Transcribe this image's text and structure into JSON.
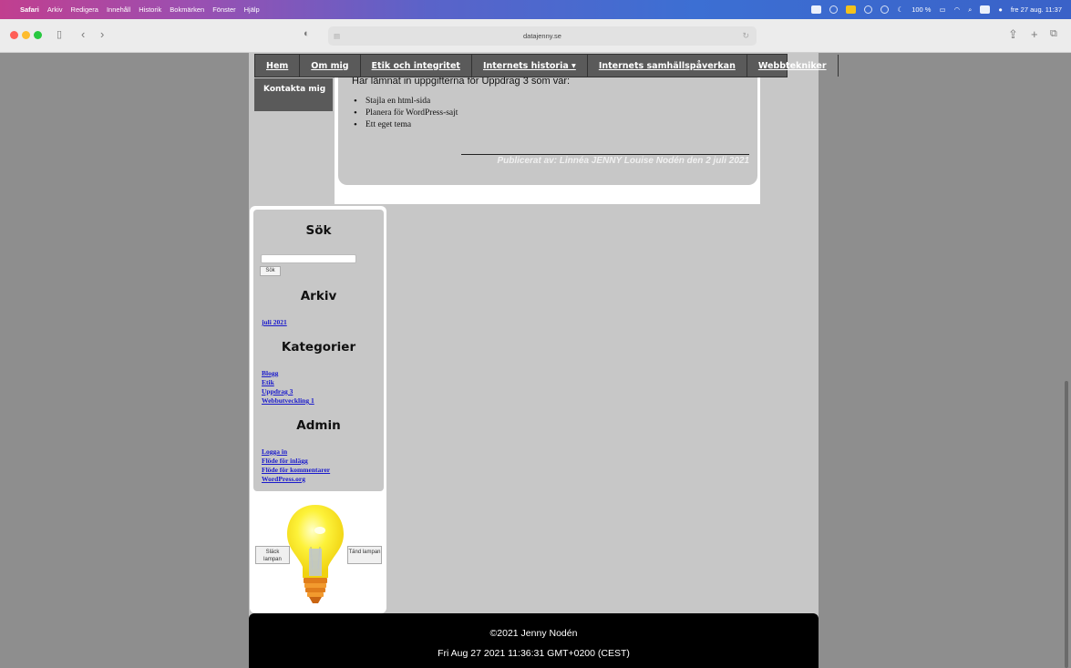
{
  "menubar": {
    "apple": "",
    "items": [
      "Safari",
      "Arkiv",
      "Redigera",
      "Innehåll",
      "Historik",
      "Bokmärken",
      "Fönster",
      "Hjälp"
    ],
    "battery": "100 %",
    "datetime": "fre 27 aug. 11:37"
  },
  "browser": {
    "url": "datajenny.se"
  },
  "nav": {
    "items": [
      "Hem",
      "Om mig",
      "Etik och integritet",
      "Internets historia ▾",
      "Internets samhällspåverkan",
      "Webbtekniker"
    ],
    "second_row": "Kontakta mig"
  },
  "post": {
    "intro": "Har lämnat in uppgifterna för Uppdrag 3 som var:",
    "items": [
      "Stajla en html-sida",
      "Planera för WordPress-sajt",
      "Ett eget tema"
    ],
    "byline": "Publicerat av: Linnéa JENNY Louise Nodén den 2 juli 2021"
  },
  "sidebar": {
    "search_heading": "Sök",
    "search_button": "Sök",
    "archive_heading": "Arkiv",
    "archive_links": [
      "juli 2021"
    ],
    "categories_heading": "Kategorier",
    "category_links": [
      "Blogg",
      "Etik",
      "Uppdrag 3",
      "Webbutveckling 1"
    ],
    "admin_heading": "Admin",
    "admin_links": [
      "Logga in",
      "Flöde för inlägg",
      "Flöde för kommentarer",
      "WordPress.org"
    ]
  },
  "lamp": {
    "off_button": "Släck lampan",
    "on_button": "Tänd lampan"
  },
  "footer": {
    "copyright": "©2021 Jenny Nodén",
    "date": "Fri Aug 27 2021 11:36:31 GMT+0200 (CEST)"
  }
}
